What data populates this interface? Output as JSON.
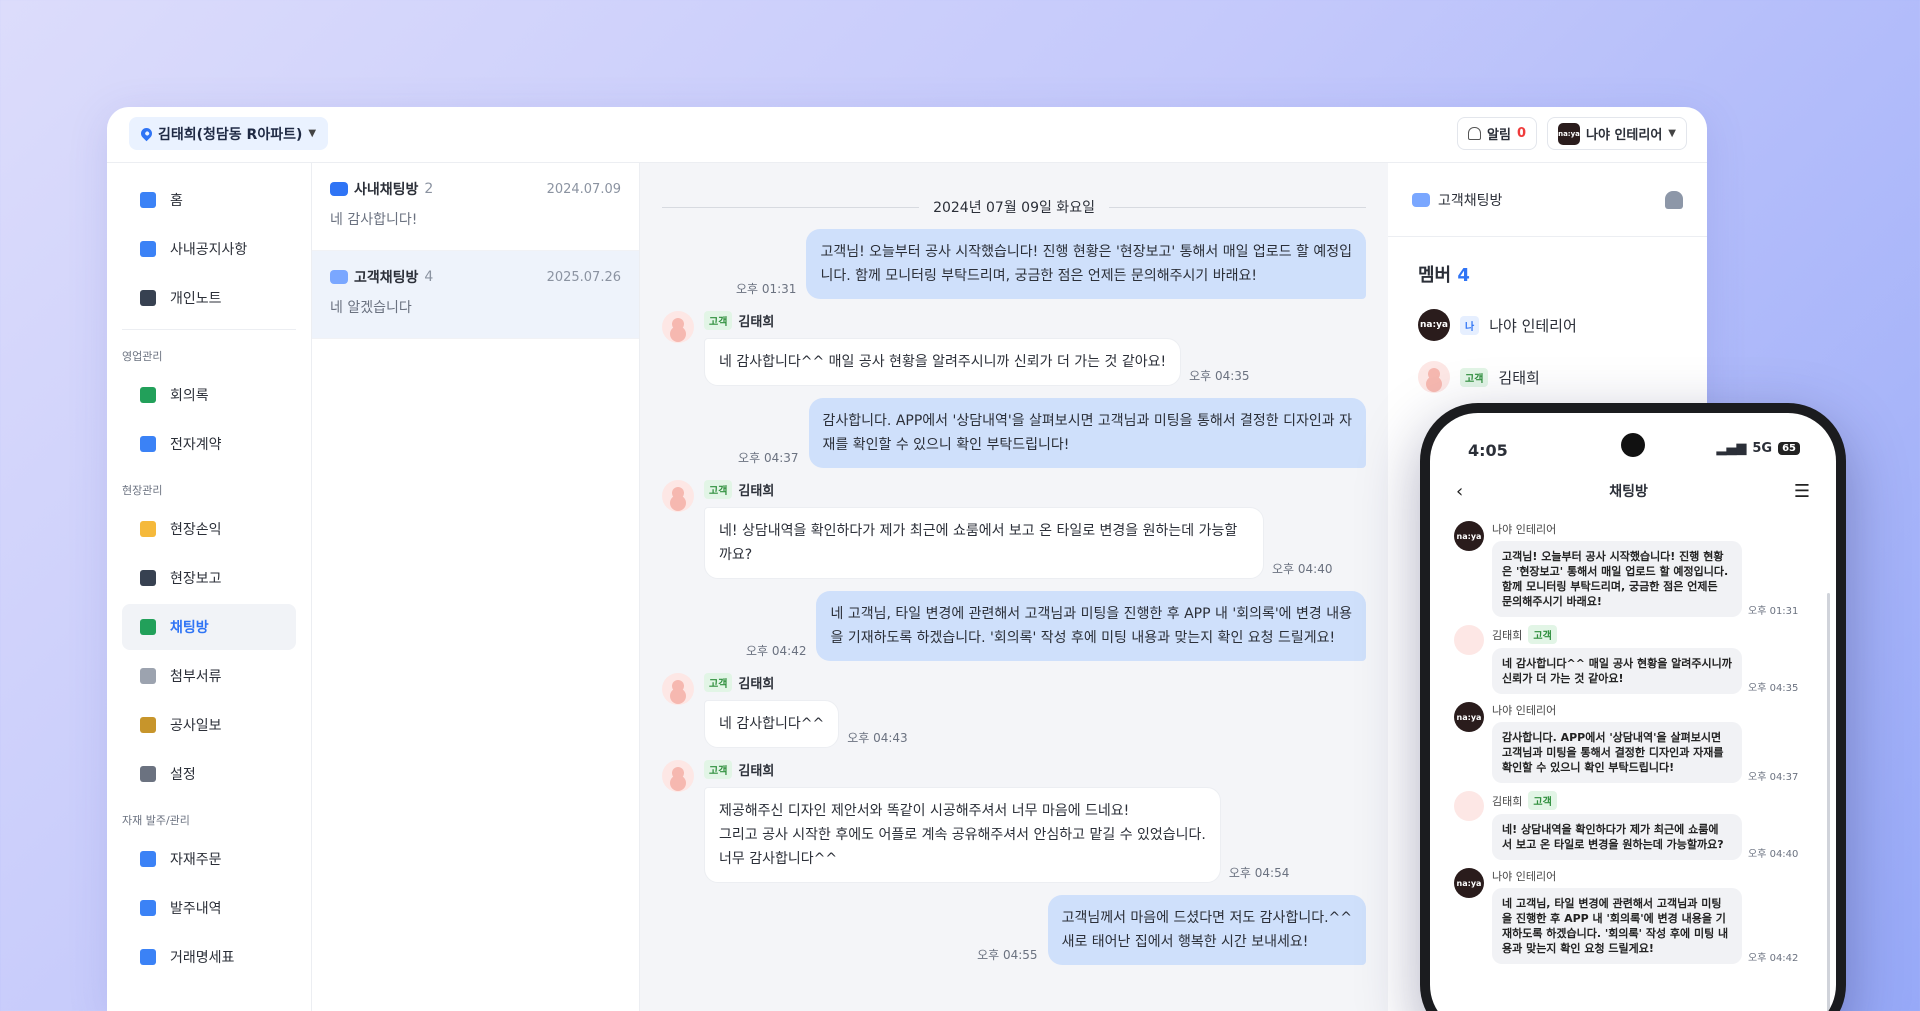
{
  "topbar": {
    "location": "김태희(청담동 R아파트)",
    "alert_label": "알림",
    "alert_count": "0",
    "company": "나야 인테리어",
    "logo_text": "na:ya"
  },
  "sidebar": {
    "items_top": [
      {
        "label": "홈",
        "icon": "home-icon",
        "color": "#3b82f6"
      },
      {
        "label": "사내공지사항",
        "icon": "megaphone-icon",
        "color": "#3b82f6"
      },
      {
        "label": "개인노트",
        "icon": "notebook-icon",
        "color": "#374151"
      }
    ],
    "section_sales": "영업관리",
    "items_sales": [
      {
        "label": "회의록",
        "icon": "minutes-icon",
        "color": "#22a05a"
      },
      {
        "label": "전자계약",
        "icon": "pen-icon",
        "color": "#3b82f6"
      }
    ],
    "section_site": "현장관리",
    "items_site": [
      {
        "label": "현장손익",
        "icon": "profit-icon",
        "color": "#f5b93b"
      },
      {
        "label": "현장보고",
        "icon": "report-icon",
        "color": "#374151"
      },
      {
        "label": "채팅방",
        "icon": "chat-icon",
        "color": "#22a05a"
      },
      {
        "label": "첨부서류",
        "icon": "document-icon",
        "color": "#9ca3af"
      },
      {
        "label": "공사일보",
        "icon": "barrier-icon",
        "color": "#c7952b"
      },
      {
        "label": "설정",
        "icon": "gear-icon",
        "color": "#6b7280"
      }
    ],
    "section_material": "자재 발주/관리",
    "items_material": [
      {
        "label": "자재주문",
        "icon": "cart-icon",
        "color": "#3b82f6"
      },
      {
        "label": "발주내역",
        "icon": "order-list-icon",
        "color": "#3b82f6"
      },
      {
        "label": "거래명세표",
        "icon": "invoice-icon",
        "color": "#3b82f6"
      }
    ]
  },
  "rooms": [
    {
      "name": "사내채팅방",
      "count": "2",
      "date": "2024.07.09",
      "last": "네 감사합니다!"
    },
    {
      "name": "고객채팅방",
      "count": "4",
      "date": "2025.07.26",
      "last": "네 알겠습니다"
    }
  ],
  "chat": {
    "date": "2024년 07월 09일 화요일",
    "messages": [
      {
        "dir": "out",
        "time": "오후 01:31",
        "lines": [
          "고객님! 오늘부터 공사 시작했습니다! 진행 현황은 '현장보고' 통해서 매일 업로드 할 예정입",
          "니다. 함께 모니터링 부탁드리며, 궁금한 점은 언제든 문의해주시기 바래요!"
        ]
      },
      {
        "dir": "in",
        "tag": "고객",
        "sender": "김태희",
        "time": "오후 04:35",
        "lines": [
          "네 감사합니다^^ 매일 공사 현황을 알려주시니까 신뢰가 더 가는 것 같아요!"
        ]
      },
      {
        "dir": "out",
        "time": "오후 04:37",
        "lines": [
          "감사합니다. APP에서 '상담내역'을 살펴보시면 고객님과 미팅을 통해서 결정한 디자인과 자",
          "재를 확인할 수 있으니 확인 부탁드립니다!"
        ]
      },
      {
        "dir": "in",
        "tag": "고객",
        "sender": "김태희",
        "time": "오후 04:40",
        "lines": [
          "네! 상담내역을 확인하다가 제가 최근에 쇼룸에서 보고 온 타일로 변경을 원하는데 가능할까요?"
        ]
      },
      {
        "dir": "out",
        "time": "오후 04:42",
        "lines": [
          "네 고객님, 타일 변경에 관련해서 고객님과 미팅을 진행한 후 APP 내 '회의록'에 변경 내용",
          "을 기재하도록 하겠습니다. '회의록' 작성 후에 미팅 내용과 맞는지 확인 요청 드릴게요!"
        ]
      },
      {
        "dir": "in",
        "tag": "고객",
        "sender": "김태희",
        "time": "오후 04:43",
        "lines": [
          "네 감사합니다^^"
        ]
      },
      {
        "dir": "in",
        "tag": "고객",
        "sender": "김태희",
        "time": "오후 04:54",
        "lines": [
          "제공해주신 디자인 제안서와 똑같이 시공해주셔서 너무 마음에 드네요!",
          "그리고 공사 시작한 후에도 어플로 계속 공유해주셔서 안심하고 맡길 수 있었습니다.",
          "너무 감사합니다^^"
        ]
      },
      {
        "dir": "out",
        "time": "오후 04:55",
        "lines": [
          "고객님께서 마음에 드셨다면 저도 감사합니다.^^",
          "새로 태어난 집에서 행복한 시간 보내세요!"
        ]
      }
    ]
  },
  "members_panel": {
    "room_name": "고객채팅방",
    "title": "멤버",
    "count": "4",
    "members": [
      {
        "tag": "나",
        "name": "나야 인테리어",
        "kind": "company"
      },
      {
        "tag": "고객",
        "name": "김태희",
        "kind": "user"
      }
    ]
  },
  "phone": {
    "time": "4:05",
    "network": "5G",
    "battery": "65",
    "title": "채팅방",
    "messages": [
      {
        "kind": "company",
        "sender": "나야 인테리어",
        "time": "오후 01:31",
        "lines": [
          "고객님! 오늘부터 공사 시작했습니다! 진행 현황",
          "은 '현장보고' 통해서 매일 업로드 할 예정입니다.",
          "함께 모니터링 부탁드리며, 궁금한 점은 언제든",
          "문의해주시기 바래요!"
        ]
      },
      {
        "kind": "user",
        "sender": "김태희",
        "tag": "고객",
        "time": "오후 04:35",
        "lines": [
          "네 감사합니다^^ 매일 공사 현황을 알려주시니까",
          "신뢰가 더 가는 것 같아요!"
        ]
      },
      {
        "kind": "company",
        "sender": "나야 인테리어",
        "time": "오후 04:37",
        "lines": [
          "감사합니다. APP에서 '상담내역'을 살펴보시면",
          "고객님과 미팅을 통해서 결정한 디자인과 자재를",
          "확인할 수 있으니 확인 부탁드립니다!"
        ]
      },
      {
        "kind": "user",
        "sender": "김태희",
        "tag": "고객",
        "time": "오후 04:40",
        "lines": [
          "네! 상담내역을 확인하다가 제가 최근에 쇼룸에",
          "서 보고 온 타일로 변경을 원하는데 가능할까요?"
        ]
      },
      {
        "kind": "company",
        "sender": "나야 인테리어",
        "time": "오후 04:42",
        "lines": [
          "네 고객님, 타일 변경에 관련해서 고객님과 미팅",
          "을 진행한 후 APP 내 '회의록'에 변경 내용을 기",
          "재하도록 하겠습니다. '회의록' 작성 후에 미팅 내",
          "용과 맞는지 확인 요청 드릴게요!"
        ]
      }
    ]
  }
}
